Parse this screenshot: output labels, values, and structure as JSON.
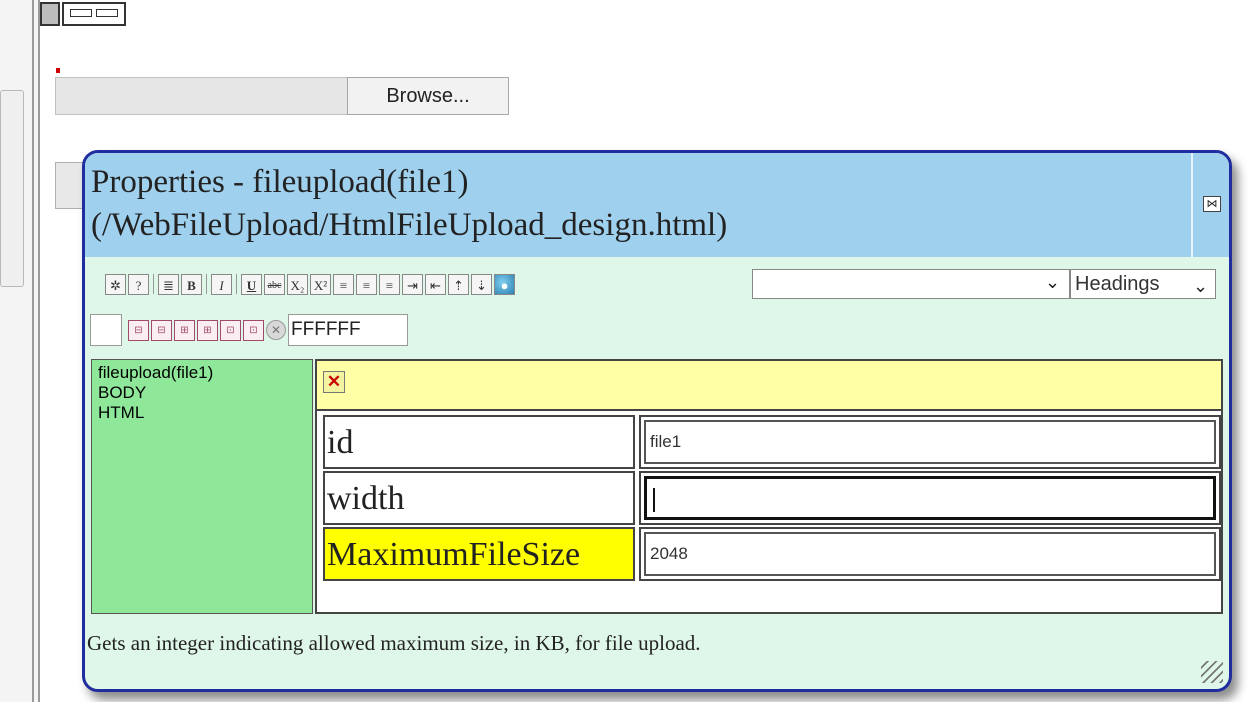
{
  "background": {
    "browse_label": "Browse..."
  },
  "dialog": {
    "title_line1": "Properties - fileupload(file1)",
    "title_line2": "(/WebFileUpload/HtmlFileUpload_design.html)",
    "toolbar1": {
      "buttons": [
        "✲",
        "?",
        "≣",
        "B",
        "I",
        "U",
        "abc",
        "X₂",
        "X²",
        "≡",
        "≡",
        "≡",
        "⇥",
        "⇤",
        "⇡",
        "⇣"
      ],
      "font_select_value": "",
      "heading_select_value": "Headings"
    },
    "toolbar2": {
      "color_value": "FFFFFF"
    },
    "tree": [
      "fileupload(file1)",
      "BODY",
      "HTML"
    ],
    "properties": [
      {
        "name": "id",
        "value": "file1"
      },
      {
        "name": "width",
        "value": ""
      },
      {
        "name": "MaximumFileSize",
        "value": "2048"
      }
    ],
    "description": "Gets an integer indicating allowed maximum size, in KB, for file upload."
  },
  "colors": {
    "title_bar": "#9fd0ee",
    "dialog_bg": "#dff7e8",
    "border": "#1f2d9e",
    "tree_bg": "#8fe89a",
    "grid_head": "#ffffa6",
    "selected_prop": "#ffff00"
  }
}
